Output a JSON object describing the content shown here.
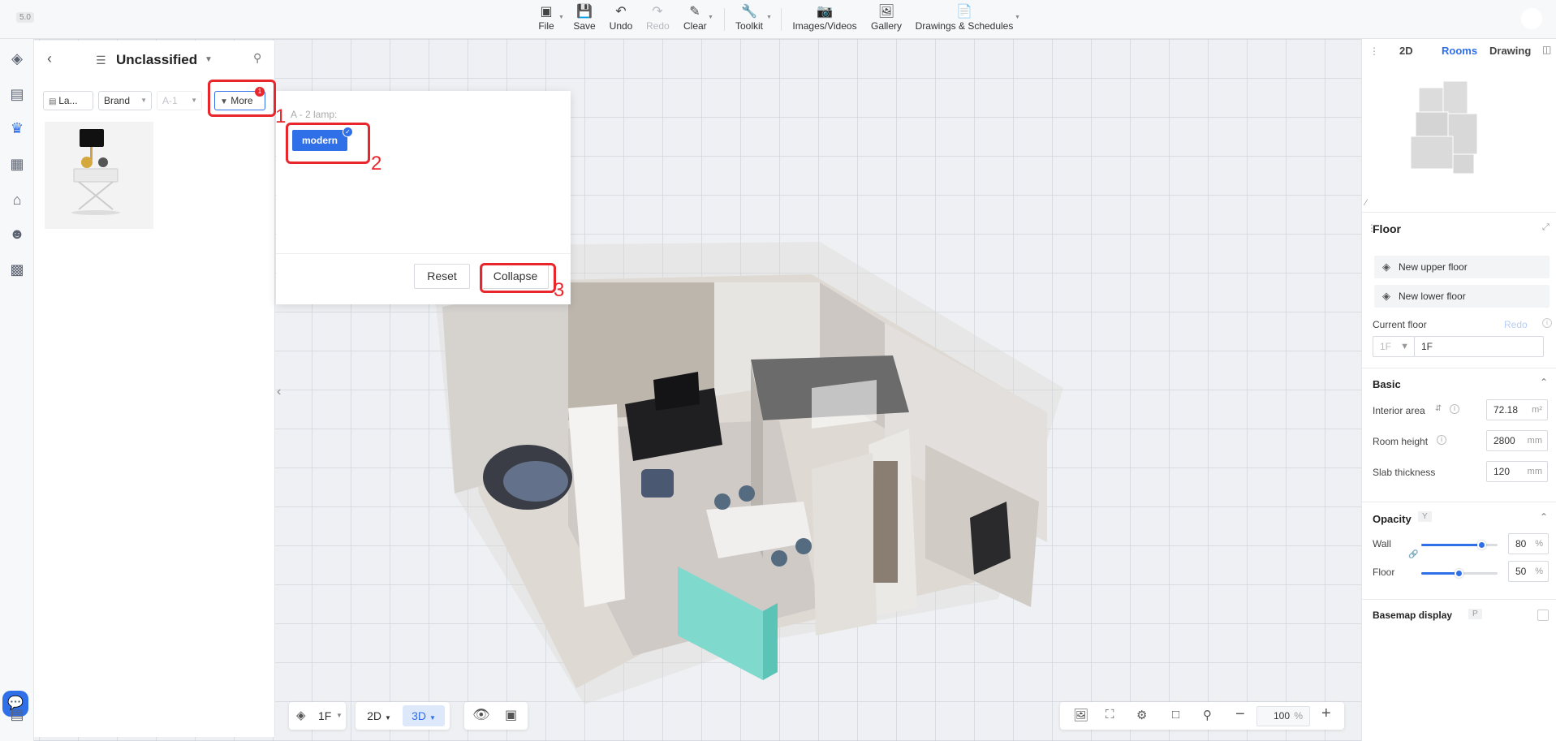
{
  "app": {
    "version": "5.0"
  },
  "toolbar": {
    "file": "File",
    "save": "Save",
    "undo": "Undo",
    "redo": "Redo",
    "clear": "Clear",
    "toolkit": "Toolkit",
    "images_videos": "Images/Videos",
    "gallery": "Gallery",
    "drawings": "Drawings & Schedules"
  },
  "library": {
    "title": "Unclassified",
    "filters": {
      "layout": "La...",
      "brand": "Brand",
      "area": "A-1",
      "more": "More",
      "more_badge": "1"
    }
  },
  "filter_panel": {
    "group_label": "A - 2 lamp:",
    "tag": "modern",
    "reset": "Reset",
    "collapse": "Collapse"
  },
  "annotations": {
    "n1": "1",
    "n2": "2",
    "n3": "3"
  },
  "right_panel": {
    "tabs": {
      "tab2d": "2D",
      "rooms": "Rooms",
      "drawing": "Drawing"
    },
    "floor_title": "Floor",
    "new_upper": "New upper floor",
    "new_lower": "New lower floor",
    "current_floor_label": "Current floor",
    "redo": "Redo",
    "floor_select": "1F",
    "floor_name": "1F",
    "basic_title": "Basic",
    "interior_area_label": "Interior area",
    "interior_area_value": "72.18",
    "interior_area_unit": "m²",
    "room_height_label": "Room height",
    "room_height_value": "2800",
    "room_height_unit": "mm",
    "slab_label": "Slab thickness",
    "slab_value": "120",
    "slab_unit": "mm",
    "opacity_title": "Opacity",
    "opacity_key": "Y",
    "wall_label": "Wall",
    "wall_value": "80",
    "wall_fraction": 0.8,
    "floor_label": "Floor",
    "floor_value": "50",
    "floor_fraction": 0.5,
    "percent": "%",
    "basemap_label": "Basemap display",
    "basemap_key": "P"
  },
  "bottom": {
    "floor": "1F",
    "view2d": "2D",
    "view3d": "3D",
    "zoom": "100",
    "percent": "%"
  },
  "colors": {
    "accent": "#2f6fe8",
    "annotation": "#e8262b"
  }
}
